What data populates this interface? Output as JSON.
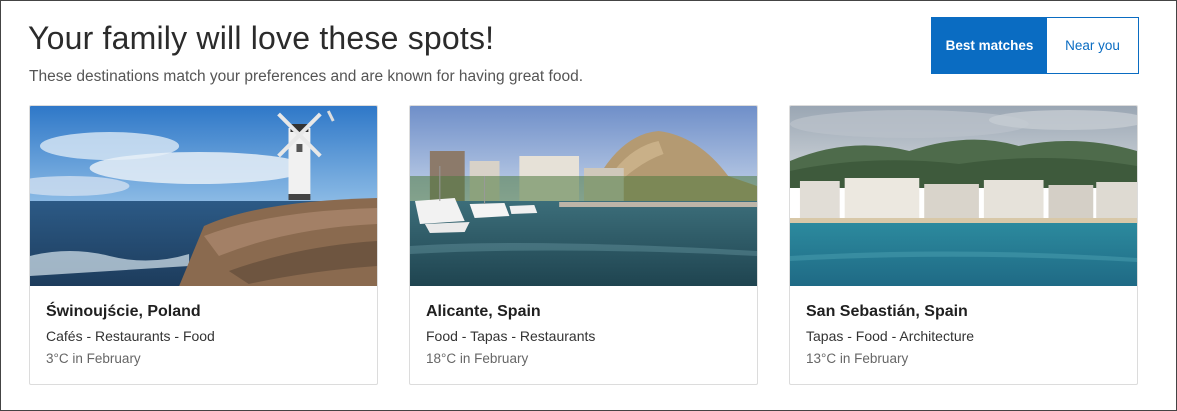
{
  "header": {
    "title": "Your family will love these spots!",
    "subtitle": "These destinations match your preferences and are known for having great food."
  },
  "toggle": {
    "options": [
      "Best matches",
      "Near you"
    ],
    "selected": "Best matches",
    "accent_color": "#0a6cc2"
  },
  "cards": [
    {
      "name": "Świnoujście, Poland",
      "tags": "Cafés - Restaurants - Food",
      "temp": "3°C in February",
      "image": "lighthouse-windmill-on-rocky-pier-by-sea"
    },
    {
      "name": "Alicante, Spain",
      "tags": "Food - Tapas - Restaurants",
      "temp": "18°C in February",
      "image": "harbor-with-boats-and-hill-castle"
    },
    {
      "name": "San Sebastián, Spain",
      "tags": "Tapas - Food - Architecture",
      "temp": "13°C in February",
      "image": "coastal-city-with-mountains-and-bay"
    }
  ]
}
